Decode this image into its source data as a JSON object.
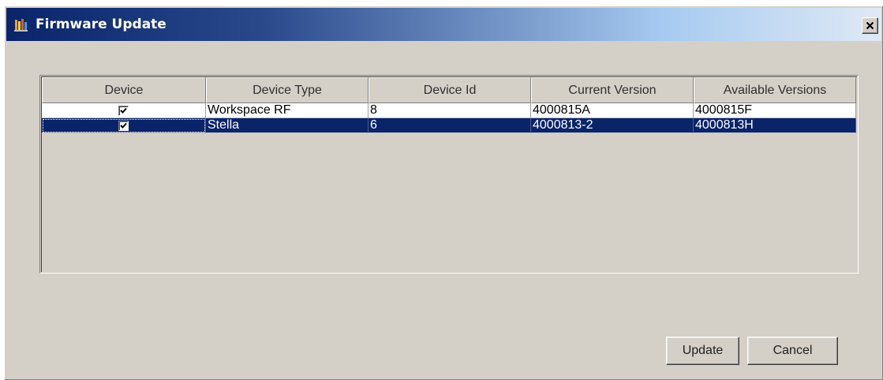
{
  "window": {
    "title": "Firmware Update",
    "close_label": "×"
  },
  "grid": {
    "columns": [
      "Device",
      "Device Type",
      "Device Id",
      "Current Version",
      "Available Versions"
    ],
    "rows": [
      {
        "checked": true,
        "device_type": "Workspace RF",
        "device_id": "8",
        "current_version": "4000815A",
        "available_version": "4000815F",
        "selected": false
      },
      {
        "checked": true,
        "device_type": "Stella",
        "device_id": "6",
        "current_version": "4000813-2",
        "available_version": "4000813H",
        "selected": true
      }
    ]
  },
  "buttons": {
    "update": "Update",
    "cancel": "Cancel"
  },
  "colors": {
    "title_gradient_start": "#0a246a",
    "selection": "#0a246a",
    "face": "#d4d0c8"
  },
  "icons": {
    "app": "firmware-app-icon",
    "close": "close-icon",
    "check": "check-icon"
  }
}
